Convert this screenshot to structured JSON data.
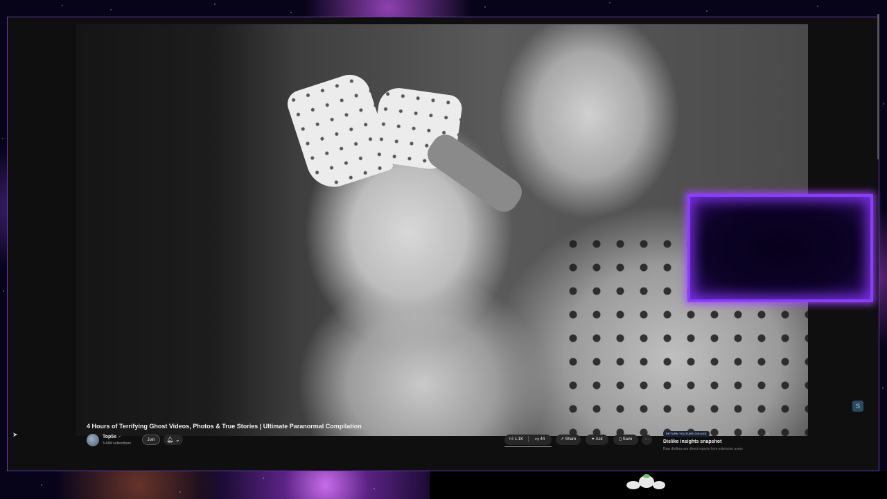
{
  "video": {
    "title": "4 Hours of Terrifying Ghost Videos, Photos & True Stories | Ultimate Paranormal Compilation"
  },
  "channel": {
    "name": "Top5s",
    "subscribers": "3.44M subscribers",
    "join_label": "Join",
    "bell_icon": "bell-icon",
    "verified_icon": "verified-check-icon"
  },
  "actions": {
    "likes": "1.1K",
    "dislikes": "44",
    "share_label": "Share",
    "ask_label": "Ask",
    "save_label": "Save",
    "more_label": "···"
  },
  "return_youtube_dislike": {
    "badge": "RETURN YOUTUBE DISLIKE",
    "heading": "Dislike insights snapshot",
    "subtitle": "Raw dislikes are direct reports from extension users",
    "close_label": "×"
  },
  "colors": {
    "overlay_border": "#8a3cff",
    "window_border": "#6a3bb8",
    "page_background": "#0f0f0f"
  }
}
